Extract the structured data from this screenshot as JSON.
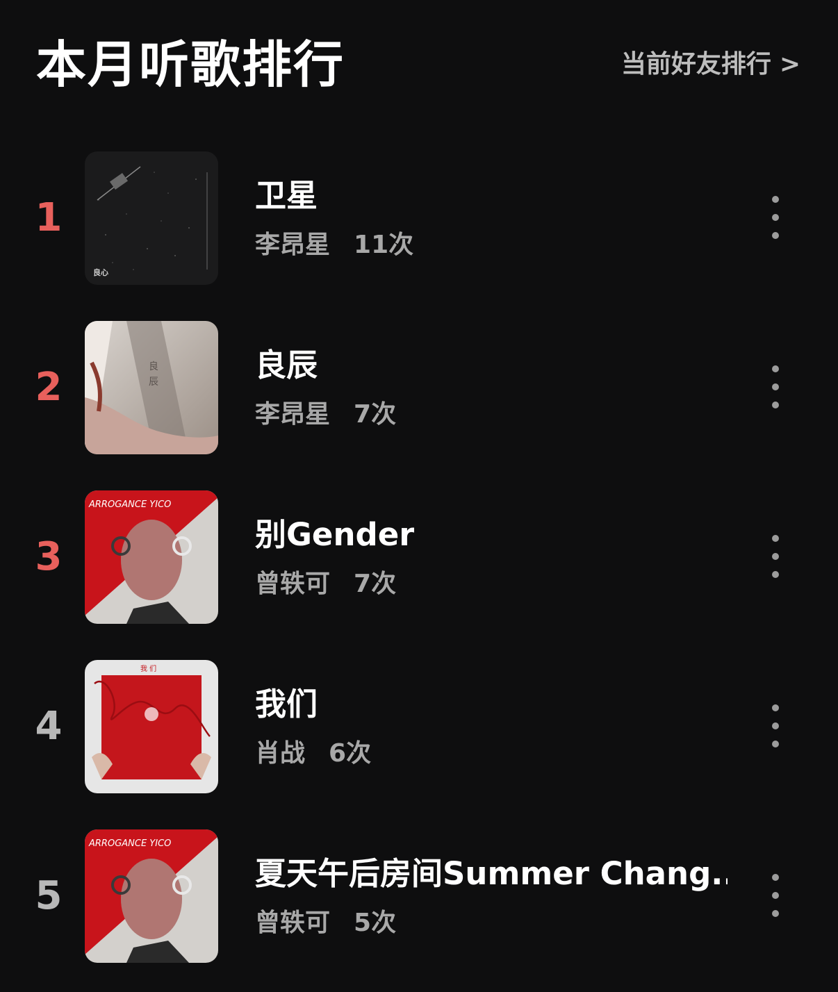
{
  "header": {
    "title": "本月听歌排行",
    "friends_link": "当前好友排行",
    "chevron": ">"
  },
  "colors": {
    "background": "#0e0e0f",
    "rank_top": "#e8605c",
    "rank_other": "#b8b8b8",
    "subtitle": "#a8a8a8"
  },
  "songs": [
    {
      "rank": "1",
      "title": "卫星",
      "artist": "李昂星",
      "plays": "11次",
      "cover": "satellite-cover-art"
    },
    {
      "rank": "2",
      "title": "良辰",
      "artist": "李昂星",
      "plays": "7次",
      "cover": "liangchen-cover-art"
    },
    {
      "rank": "3",
      "title": "别Gender",
      "artist": "曾轶可",
      "plays": "7次",
      "cover": "arrogance-cover-art"
    },
    {
      "rank": "4",
      "title": "我们",
      "artist": "肖战",
      "plays": "6次",
      "cover": "women-cover-art"
    },
    {
      "rank": "5",
      "title": "夏天午后房间Summer Chang...",
      "artist": "曾轶可",
      "plays": "5次",
      "cover": "arrogance-cover-art"
    }
  ]
}
